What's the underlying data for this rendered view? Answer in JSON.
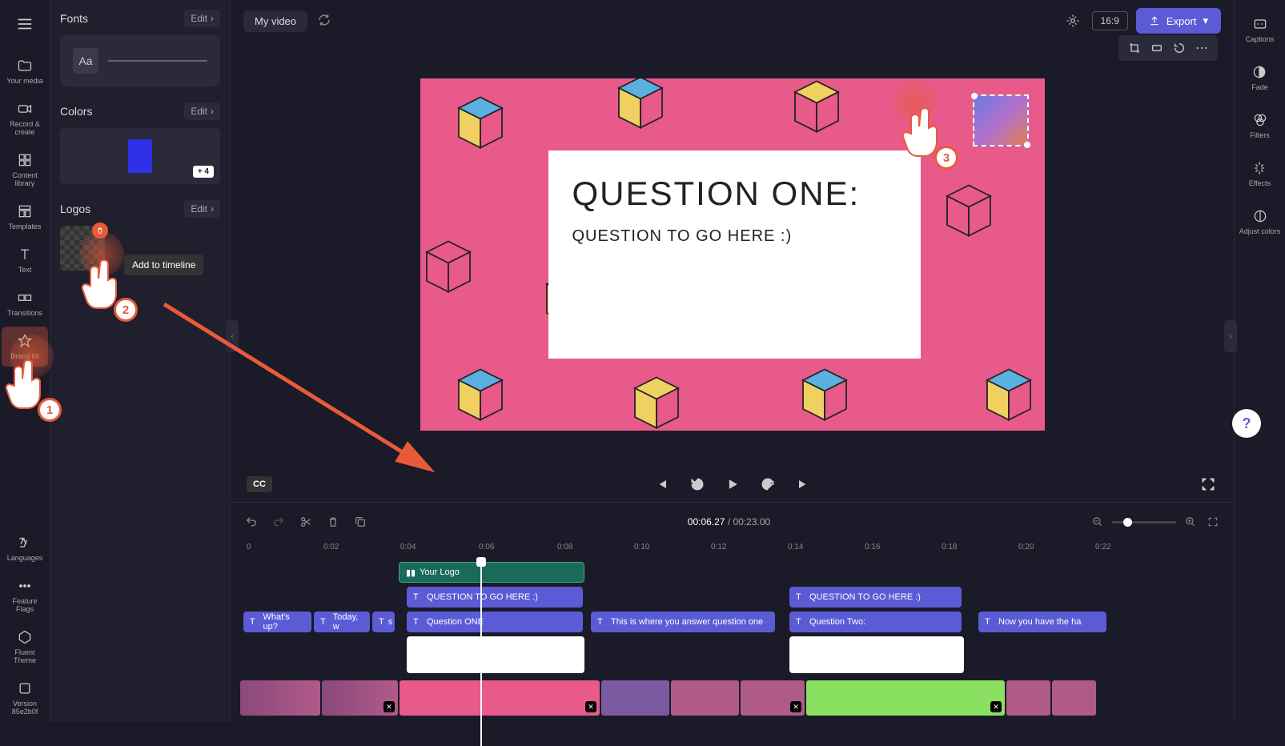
{
  "header": {
    "title": "My video",
    "export_label": "Export",
    "aspect": "16:9"
  },
  "left_rail": {
    "your_media": "Your media",
    "record_create": "Record & create",
    "content_library": "Content library",
    "templates": "Templates",
    "text": "Text",
    "transitions": "Transitions",
    "brand_kit": "Brand kit",
    "languages": "Languages",
    "feature_flags": "Feature Flags",
    "fluent_theme": "Fluent Theme",
    "version": "Version 85e2b0f"
  },
  "panel": {
    "fonts_title": "Fonts",
    "colors_title": "Colors",
    "logos_title": "Logos",
    "edit_label": "Edit",
    "font_sample": "Aa",
    "colors_more": "+ 4",
    "logo_tooltip": "Add to timeline"
  },
  "right_rail": {
    "captions": "Captions",
    "fade": "Fade",
    "filters": "Filters",
    "effects": "Effects",
    "adjust_colors": "Adjust colors"
  },
  "canvas": {
    "question_title": "QUESTION ONE:",
    "question_sub": "QUESTION TO GO HERE :)"
  },
  "playback": {
    "cc": "CC",
    "current": "00:06.27",
    "total": "00:23.00"
  },
  "ruler": [
    "0",
    "0:02",
    "0:04",
    "0:06",
    "0:08",
    "0:10",
    "0:12",
    "0:14",
    "0:16",
    "0:18",
    "0:20",
    "0:22"
  ],
  "clips": {
    "logo": "Your Logo",
    "q_here_1": "QUESTION TO GO HERE :)",
    "q_here_2": "QUESTION TO GO HERE :)",
    "whats_up": "What's up?",
    "today_w": "Today, w",
    "s": "s",
    "question_one": "Question ONE",
    "answer": "This is where you answer question one",
    "question_two": "Question Two:",
    "now_you": "Now you have the ha"
  },
  "annotations": {
    "n1": "1",
    "n2": "2",
    "n3": "3"
  },
  "help": "?"
}
